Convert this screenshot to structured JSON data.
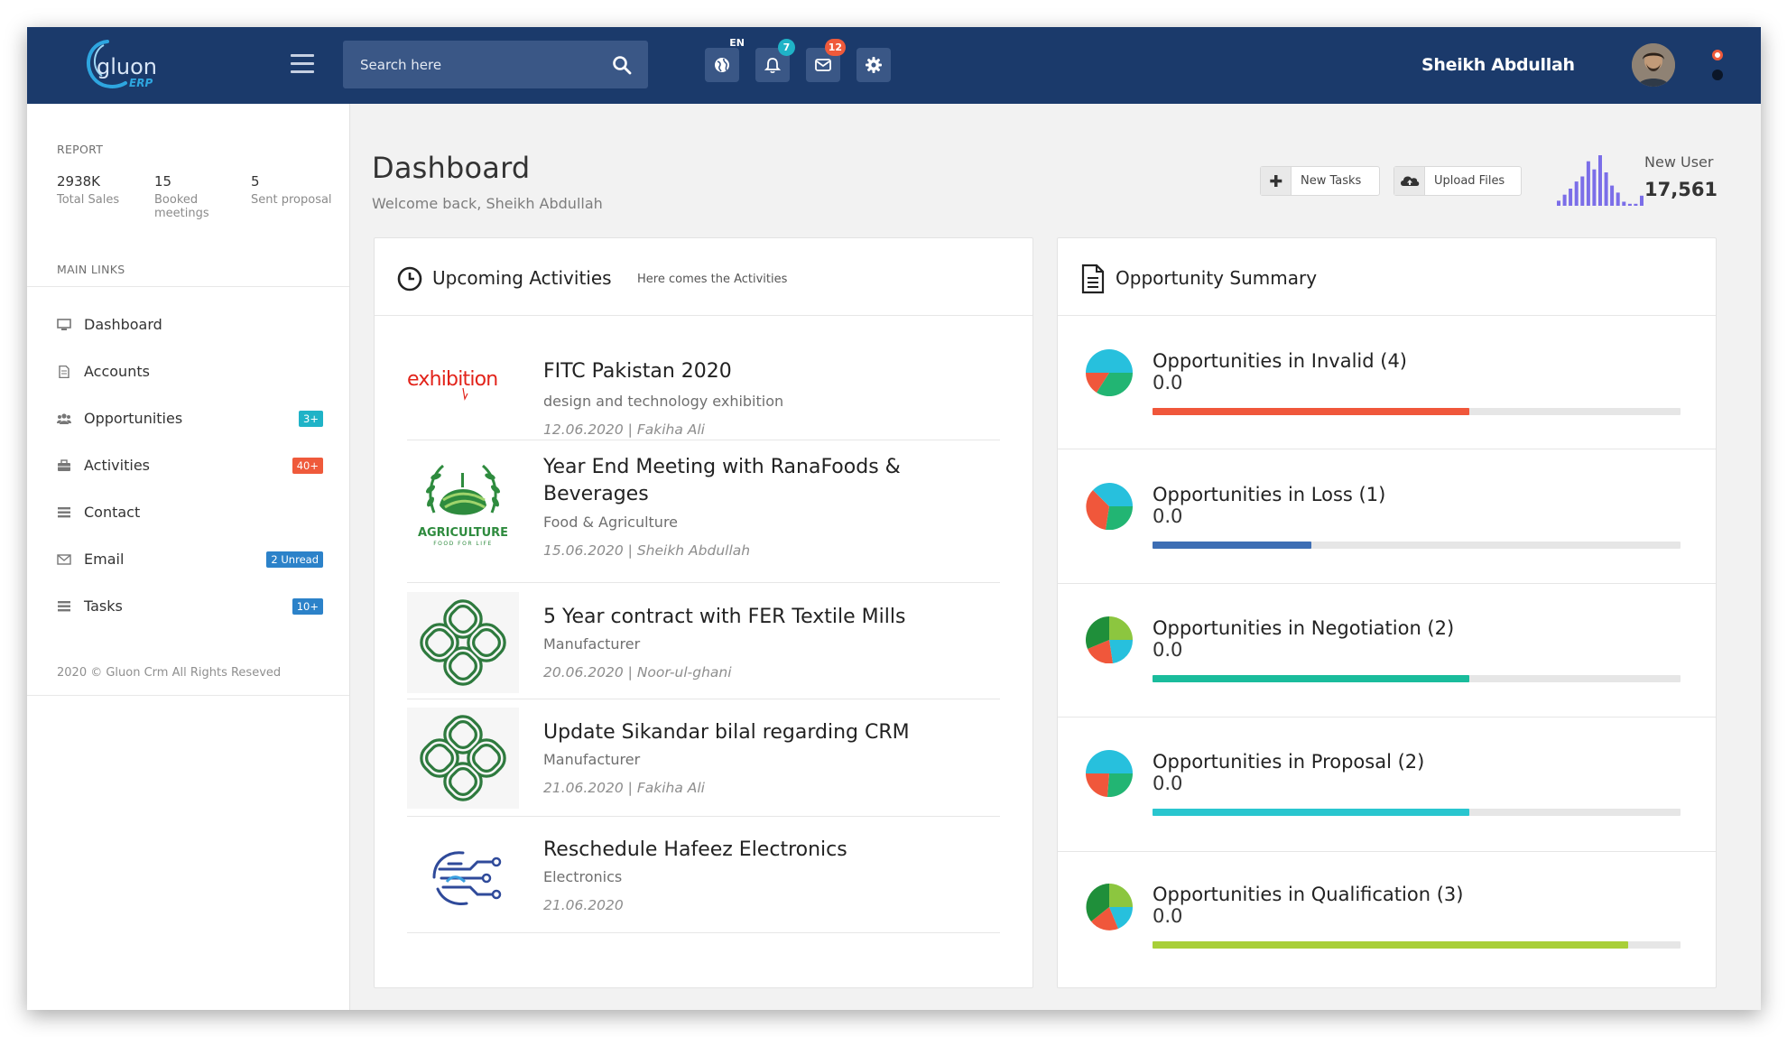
{
  "header": {
    "logo_text": "gluon",
    "logo_sub": "ERP",
    "search_placeholder": "Search here",
    "language": "EN",
    "notifications_count": "7",
    "messages_count": "12",
    "username": "Sheikh Abdullah",
    "colors": {
      "bar": "#1b3a6b",
      "badge_teal": "#1fb3c7",
      "badge_red": "#ef5a3b"
    }
  },
  "sidebar": {
    "report_heading": "REPORT",
    "stats": [
      {
        "value": "2938K",
        "label": "Total Sales"
      },
      {
        "value": "15",
        "label": "Booked meetings"
      },
      {
        "value": "5",
        "label": "Sent proposal"
      }
    ],
    "main_links_heading": "MAIN LINKS",
    "items": [
      {
        "label": "Dashboard",
        "icon": "monitor-icon",
        "badge": ""
      },
      {
        "label": "Accounts",
        "icon": "document-icon",
        "badge": ""
      },
      {
        "label": "Opportunities",
        "icon": "users-icon",
        "badge": "3+",
        "badge_color": "#1fb3c7"
      },
      {
        "label": "Activities",
        "icon": "briefcase-icon",
        "badge": "40+",
        "badge_color": "#ef5a3b"
      },
      {
        "label": "Contact",
        "icon": "list-icon",
        "badge": ""
      },
      {
        "label": "Email",
        "icon": "envelope-icon",
        "badge": "2 Unread",
        "badge_color": "#2c82c9"
      },
      {
        "label": "Tasks",
        "icon": "list-icon",
        "badge": "10+",
        "badge_color": "#2c82c9"
      }
    ],
    "copyright": "2020 © Gluon Crm All Rights Reseved"
  },
  "main": {
    "title": "Dashboard",
    "subtitle": "Welcome back, Sheikh Abdullah",
    "new_tasks_label": "New Tasks",
    "upload_files_label": "Upload Files",
    "new_user_label": "New User",
    "new_user_value": "17,561",
    "new_user_bars": [
      10,
      22,
      34,
      48,
      58,
      88,
      72,
      100,
      66,
      40,
      26,
      8,
      4,
      4,
      20
    ],
    "accent": "#7b6ee8"
  },
  "activities": {
    "title": "Upcoming Activities",
    "subtitle": "Here comes the Activities",
    "items": [
      {
        "logo": "exhibition-logo",
        "logo_text": "exhibition",
        "title": "FITC Pakistan 2020",
        "category": "design and technology exhibition",
        "meta": "12.06.2020 | Fakiha Ali"
      },
      {
        "logo": "agriculture-logo",
        "logo_text": "AGRICULTURE",
        "logo_sub": "FOOD FOR LIFE",
        "title": "Year End Meeting with RanaFoods & Beverages",
        "category": "Food & Agriculture",
        "meta": "15.06.2020 | Sheikh Abdullah"
      },
      {
        "logo": "celtic-knot-logo",
        "title": "5 Year contract with FER Textile Mills",
        "category": "Manufacturer",
        "meta": "20.06.2020 | Noor-ul-ghani"
      },
      {
        "logo": "celtic-knot-logo",
        "title": "Update Sikandar bilal regarding CRM",
        "category": "Manufacturer",
        "meta": "21.06.2020 | Fakiha Ali"
      },
      {
        "logo": "circuit-logo",
        "title": "Reschedule Hafeez Electronics",
        "category": "Electronics",
        "meta": "21.06.2020"
      }
    ]
  },
  "opportunities": {
    "title": "Opportunity Summary",
    "items": [
      {
        "label": "Opportunities in Invalid (4)",
        "value": "0.0",
        "progress": 0.6,
        "color": "#f0573b",
        "pie": [
          "#27c0dd",
          "#22b573",
          "#f0573b"
        ]
      },
      {
        "label": "Opportunities in Loss (1)",
        "value": "0.0",
        "progress": 0.3,
        "color": "#3d6eb4",
        "pie": [
          "#27c0dd",
          "#22b573",
          "#f0573b"
        ]
      },
      {
        "label": "Opportunities in Negotiation (2)",
        "value": "0.0",
        "progress": 0.6,
        "color": "#1abc9c",
        "pie": [
          "#8cc63f",
          "#27c0dd",
          "#f0573b",
          "#1f8f3a"
        ]
      },
      {
        "label": "Opportunities in Proposal (2)",
        "value": "0.0",
        "progress": 0.6,
        "color": "#29c6cf",
        "pie": [
          "#27c0dd",
          "#22b573",
          "#f0573b"
        ]
      },
      {
        "label": "Opportunities in Qualification (3)",
        "value": "0.0",
        "progress": 0.9,
        "color": "#a8cf38",
        "pie": [
          "#8cc63f",
          "#27c0dd",
          "#f0573b",
          "#1f8f3a"
        ]
      }
    ]
  }
}
